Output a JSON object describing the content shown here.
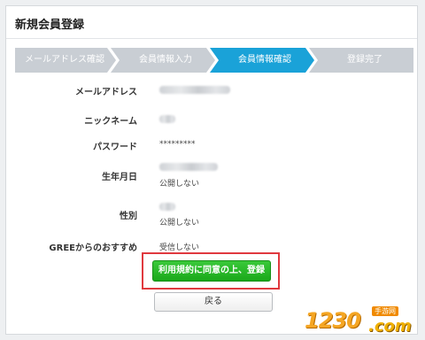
{
  "page": {
    "title": "新規会員登録"
  },
  "steps": [
    {
      "label": "メールアドレス確認",
      "state": "done"
    },
    {
      "label": "会員情報入力",
      "state": "done"
    },
    {
      "label": "会員情報確認",
      "state": "current"
    },
    {
      "label": "登録完了",
      "state": "pending"
    }
  ],
  "colors": {
    "step_inactive": "#c9ced4",
    "step_active": "#1aa2d8",
    "submit": "#22b022",
    "highlight_box": "#e0393e"
  },
  "fields": {
    "email": {
      "label": "メールアドレス"
    },
    "nickname": {
      "label": "ニックネーム"
    },
    "password": {
      "label": "パスワード",
      "value": "*********"
    },
    "birthday": {
      "label": "生年月日",
      "visibility": "公開しない"
    },
    "gender": {
      "label": "性別",
      "visibility": "公開しない"
    },
    "gree": {
      "label": "GREEからのおすすめ",
      "value": "受信しない"
    }
  },
  "buttons": {
    "submit": "利用規約に同意の上、登録",
    "back": "戻る"
  },
  "watermark": {
    "digits": "1230",
    "tag": "手游网",
    "domain": ".com"
  }
}
